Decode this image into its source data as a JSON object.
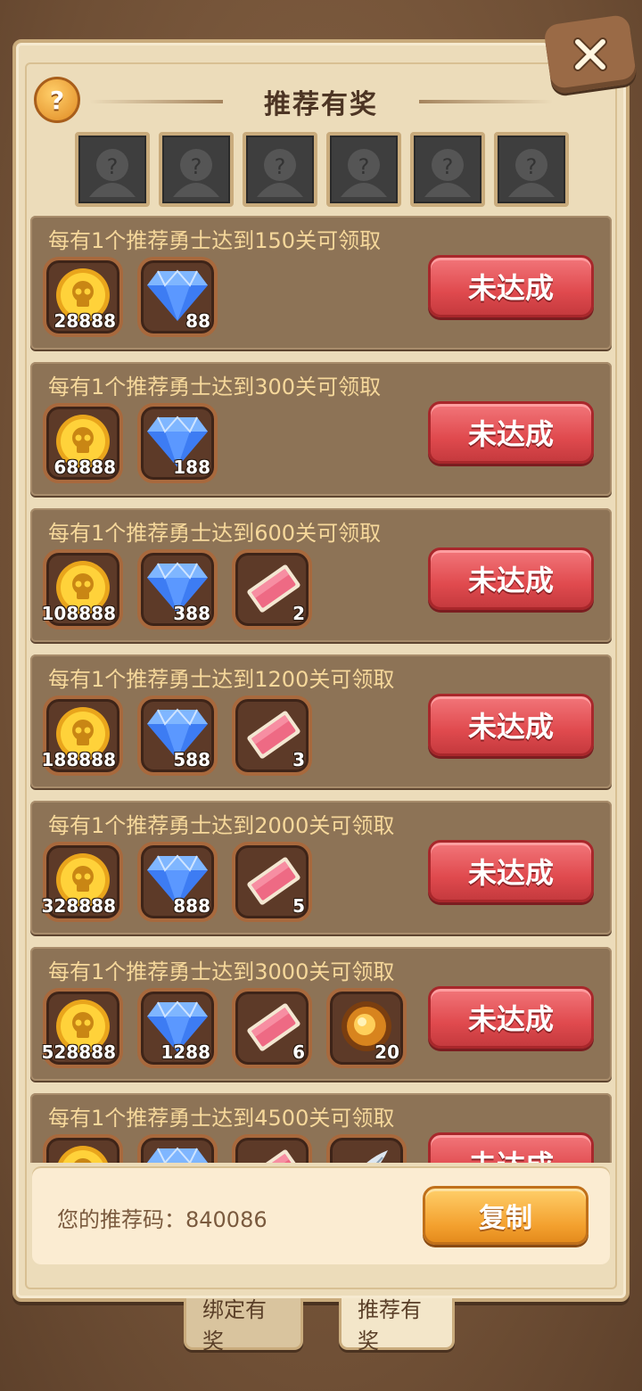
{
  "title": "推荐有奖",
  "help_label": "?",
  "avatars_count": 6,
  "rows": [
    {
      "label": "每有1个推荐勇士达到150关可领取",
      "status": "未达成",
      "items": [
        {
          "icon": "coin-icon",
          "count": "28888"
        },
        {
          "icon": "diamond-icon",
          "count": "88"
        }
      ]
    },
    {
      "label": "每有1个推荐勇士达到300关可领取",
      "status": "未达成",
      "items": [
        {
          "icon": "coin-icon",
          "count": "68888"
        },
        {
          "icon": "diamond-icon",
          "count": "188"
        }
      ]
    },
    {
      "label": "每有1个推荐勇士达到600关可领取",
      "status": "未达成",
      "items": [
        {
          "icon": "coin-icon",
          "count": "108888"
        },
        {
          "icon": "diamond-icon",
          "count": "388"
        },
        {
          "icon": "ticket-icon",
          "count": "2"
        }
      ]
    },
    {
      "label": "每有1个推荐勇士达到1200关可领取",
      "status": "未达成",
      "items": [
        {
          "icon": "coin-icon",
          "count": "188888"
        },
        {
          "icon": "diamond-icon",
          "count": "588"
        },
        {
          "icon": "ticket-icon",
          "count": "3"
        }
      ]
    },
    {
      "label": "每有1个推荐勇士达到2000关可领取",
      "status": "未达成",
      "items": [
        {
          "icon": "coin-icon",
          "count": "328888"
        },
        {
          "icon": "diamond-icon",
          "count": "888"
        },
        {
          "icon": "ticket-icon",
          "count": "5"
        }
      ]
    },
    {
      "label": "每有1个推荐勇士达到3000关可领取",
      "status": "未达成",
      "items": [
        {
          "icon": "coin-icon",
          "count": "528888"
        },
        {
          "icon": "diamond-icon",
          "count": "1288"
        },
        {
          "icon": "ticket-icon",
          "count": "6"
        },
        {
          "icon": "orb-icon",
          "count": "20"
        }
      ]
    },
    {
      "label": "每有1个推荐勇士达到4500关可领取",
      "status": "未达成",
      "items": [
        {
          "icon": "coin-icon",
          "count": ""
        },
        {
          "icon": "diamond-icon",
          "count": ""
        },
        {
          "icon": "ticket-icon",
          "count": ""
        },
        {
          "icon": "feather-icon",
          "count": ""
        }
      ]
    }
  ],
  "code": {
    "label": "您的推荐码：",
    "value": "840086",
    "copy_label": "复制"
  },
  "tabs": {
    "bind_label": "绑定有奖",
    "recommend_label": "推荐有奖"
  }
}
